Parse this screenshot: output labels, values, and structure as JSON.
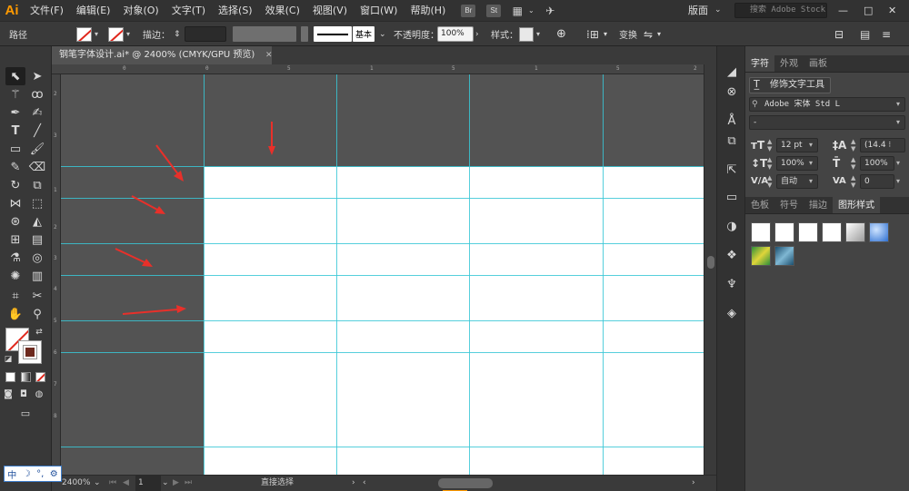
{
  "app": {
    "logo": "Ai",
    "menu": [
      "文件(F)",
      "编辑(E)",
      "对象(O)",
      "文字(T)",
      "选择(S)",
      "效果(C)",
      "视图(V)",
      "窗口(W)",
      "帮助(H)"
    ],
    "badges": [
      "Br",
      "St"
    ],
    "workspace": "版面",
    "stock_search_placeholder": "搜索 Adobe Stock",
    "window_controls": [
      "—",
      "□",
      "✕"
    ]
  },
  "control_bar": {
    "path_label": "路径",
    "stroke_label": "描边：",
    "stroke_profile": "基本",
    "opacity_label": "不透明度：",
    "opacity_value": "100%",
    "style_label": "样式：",
    "transform_label": "变换"
  },
  "document": {
    "tab_title": "钢笔字体设计.ai* @ 2400% (CMYK/GPU 预览)",
    "close_glyph": "✕"
  },
  "rulers": {
    "top": [
      "0",
      "0",
      "5",
      "1",
      "5",
      "1",
      "5",
      "2"
    ],
    "left": [
      "2",
      "3",
      "1",
      "2",
      "3",
      "4",
      "5",
      "6",
      "7",
      "8"
    ]
  },
  "status_bar": {
    "zoom": "2400%",
    "artboard_index": "1",
    "tool_name": "直接选择"
  },
  "panels": {
    "character": {
      "tabs": [
        "字符",
        "外观",
        "画板"
      ],
      "touch_type_button": "修饰文字工具",
      "font_family": "Adobe 宋体 Std L",
      "font_style": "-",
      "font_size": "12 pt",
      "leading": "(14.4 ⁝",
      "vertical_scale": "100%",
      "horizontal_scale": "100%",
      "kerning": "自动",
      "tracking": "0"
    },
    "graphic_styles": {
      "tabs": [
        "色板",
        "符号",
        "描边",
        "图形样式"
      ]
    }
  },
  "ime": {
    "items": [
      "中",
      "☽",
      "°,",
      "⚙"
    ]
  },
  "colors": {
    "guide": "#38c7d6",
    "arrow": "#e8302a",
    "canvas": "#535353",
    "artboard": "#ffffff"
  }
}
